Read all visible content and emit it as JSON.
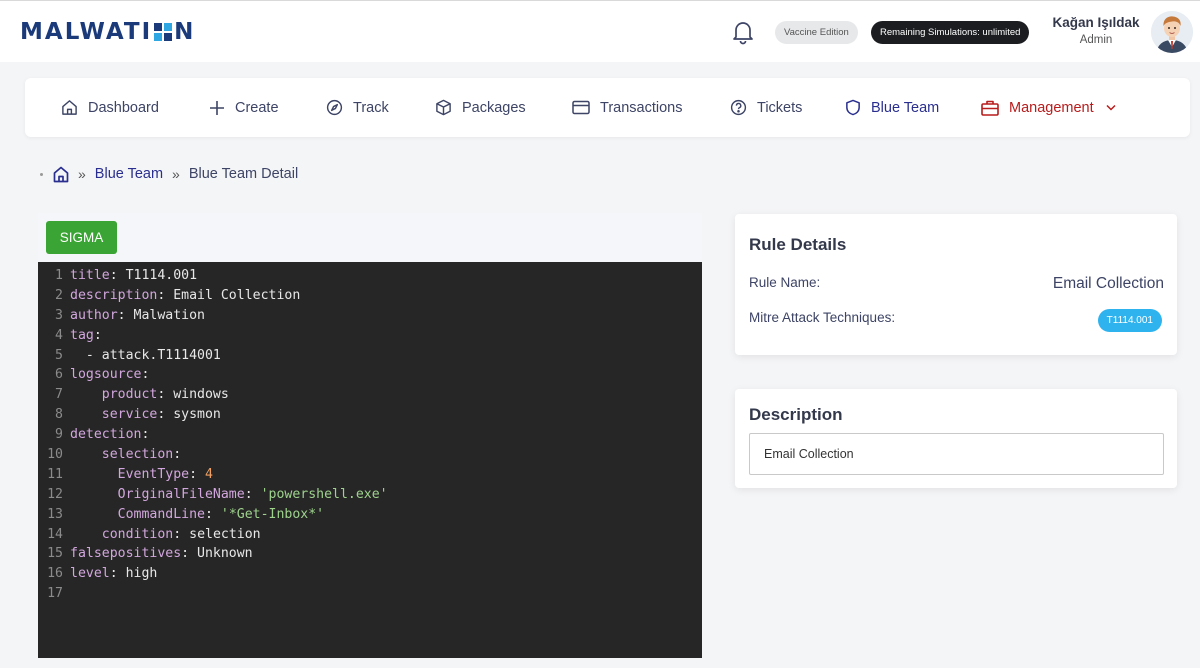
{
  "header": {
    "logo_text": [
      "MALWATI",
      "N"
    ],
    "edition_badge": "Vaccine Edition",
    "simulations_badge": "Remaining Simulations: unlimited",
    "user_name": "Kağan Işıldak",
    "user_role": "Admin",
    "icons": {
      "notifications": "bell-icon",
      "avatar": "user-avatar"
    }
  },
  "nav": {
    "items": [
      {
        "label": "Dashboard",
        "icon": "home-icon"
      },
      {
        "label": "Create",
        "icon": "plus-icon"
      },
      {
        "label": "Track",
        "icon": "compass-icon"
      },
      {
        "label": "Packages",
        "icon": "box-icon"
      },
      {
        "label": "Transactions",
        "icon": "credit-card-icon"
      },
      {
        "label": "Tickets",
        "icon": "help-circle-icon"
      },
      {
        "label": "Blue Team",
        "icon": "shield-icon",
        "color": "#2a2f8f"
      },
      {
        "label": "Management",
        "icon": "briefcase-icon",
        "color": "#b81c1c"
      }
    ]
  },
  "breadcrumb": {
    "home_icon": "home-icon",
    "separator": "»",
    "link": "Blue Team",
    "current": "Blue Team Detail"
  },
  "editor": {
    "tab_label": "SIGMA",
    "lines": [
      {
        "num": "1",
        "indent": "",
        "key": "title",
        "value": "T1114.001",
        "type": "plain"
      },
      {
        "num": "2",
        "indent": "",
        "key": "description",
        "value": "Email Collection",
        "type": "plain"
      },
      {
        "num": "3",
        "indent": "",
        "key": "author",
        "value": "Malwation",
        "type": "plain"
      },
      {
        "num": "4",
        "indent": "",
        "key": "tag",
        "value": "",
        "type": "plain"
      },
      {
        "num": "5",
        "indent": "  ",
        "key": "",
        "value": "- attack.T1114001",
        "type": "plain"
      },
      {
        "num": "6",
        "indent": "",
        "key": "logsource",
        "value": "",
        "type": "plain"
      },
      {
        "num": "7",
        "indent": "    ",
        "key": "product",
        "value": "windows",
        "type": "plain"
      },
      {
        "num": "8",
        "indent": "    ",
        "key": "service",
        "value": "sysmon",
        "type": "plain"
      },
      {
        "num": "9",
        "indent": "",
        "key": "detection",
        "value": "",
        "type": "plain"
      },
      {
        "num": "10",
        "indent": "    ",
        "key": "selection",
        "value": "",
        "type": "plain"
      },
      {
        "num": "11",
        "indent": "      ",
        "key": "EventType",
        "value": "4",
        "type": "number"
      },
      {
        "num": "12",
        "indent": "      ",
        "key": "OriginalFileName",
        "value": "'powershell.exe'",
        "type": "string"
      },
      {
        "num": "13",
        "indent": "      ",
        "key": "CommandLine",
        "value": "'*Get-Inbox*'",
        "type": "string"
      },
      {
        "num": "14",
        "indent": "    ",
        "key": "condition",
        "value": "selection",
        "type": "plain"
      },
      {
        "num": "15",
        "indent": "",
        "key": "falsepositives",
        "value": "Unknown",
        "type": "plain"
      },
      {
        "num": "16",
        "indent": "",
        "key": "level",
        "value": "high",
        "type": "plain"
      },
      {
        "num": "17",
        "indent": "",
        "key": "",
        "value": "",
        "type": "plain"
      }
    ]
  },
  "rule_details": {
    "title": "Rule Details",
    "rule_name_label": "Rule Name:",
    "rule_name_value": "Email Collection",
    "mitre_label": "Mitre Attack Techniques:",
    "mitre_badge": "T1114.001"
  },
  "description": {
    "title": "Description",
    "value": "Email Collection"
  }
}
